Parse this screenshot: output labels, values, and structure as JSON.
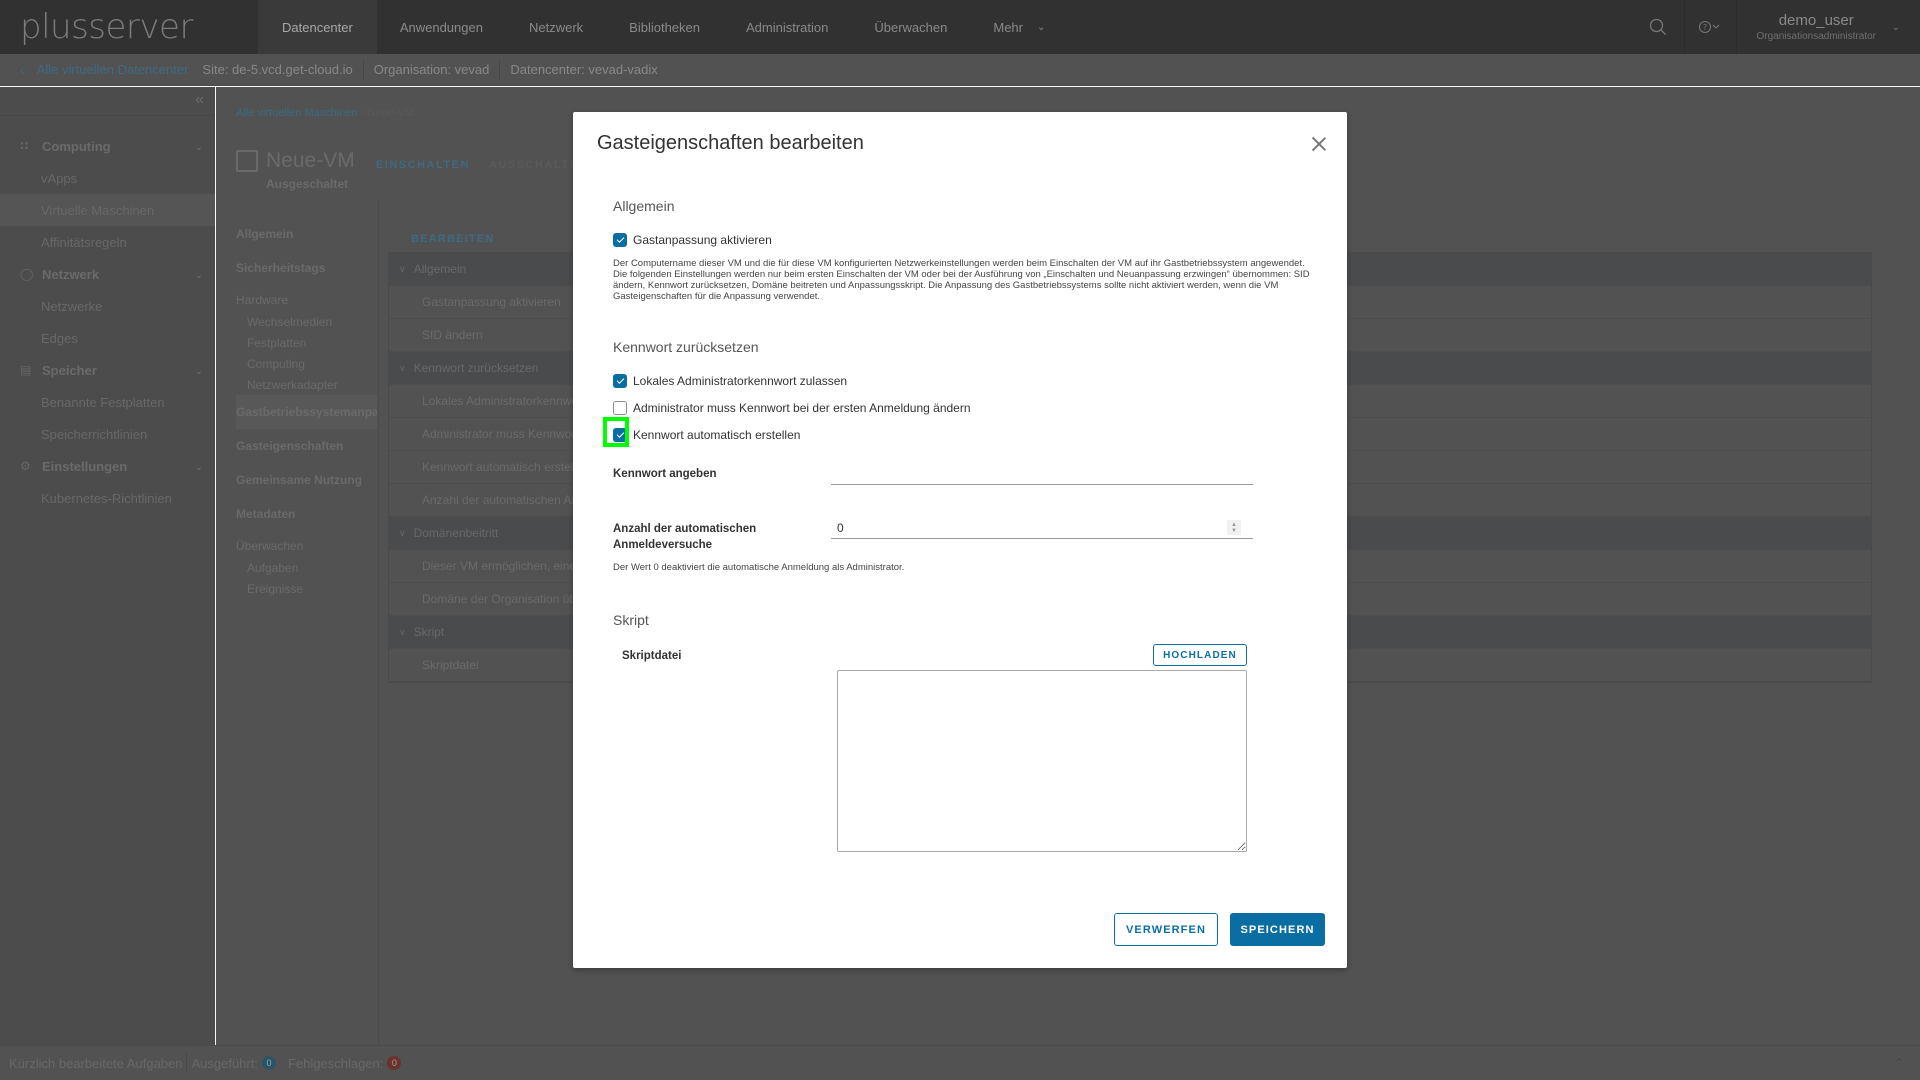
{
  "header": {
    "logo": "plusserver",
    "nav": [
      {
        "label": "Datencenter",
        "active": true
      },
      {
        "label": "Anwendungen"
      },
      {
        "label": "Netzwerk"
      },
      {
        "label": "Bibliotheken"
      },
      {
        "label": "Administration"
      },
      {
        "label": "Überwachen"
      },
      {
        "label": "Mehr"
      }
    ],
    "user_name": "demo_user",
    "user_role": "Organisationsadministrator"
  },
  "subheader": {
    "back_label": "Alle virtuellen Datencenter",
    "site": "Site: de-5.vcd.get-cloud.io",
    "organisation": "Organisation: vevad",
    "datacenter": "Datencenter: vevad-vadix"
  },
  "sidebar": {
    "groups": [
      {
        "label": "Computing",
        "icon": "grid-icon",
        "items": [
          "vApps",
          "Virtuelle Maschinen",
          "Affinitätsregeln"
        ]
      },
      {
        "label": "Netzwerk",
        "icon": "network-icon",
        "items": [
          "Netzwerke",
          "Edges"
        ]
      },
      {
        "label": "Speicher",
        "icon": "storage-icon",
        "items": [
          "Benannte Festplatten",
          "Speicherrichtlinien"
        ]
      },
      {
        "label": "Einstellungen",
        "icon": "gear-icon",
        "items": [
          "Kubernetes-Richtlinien"
        ]
      }
    ],
    "active_item": "Virtuelle Maschinen"
  },
  "main": {
    "breadcrumb_link": "Alle virtuellen Maschinen",
    "breadcrumb_current": "Neue-VM",
    "vm_name": "Neue-VM",
    "vm_status": "Ausgeschaltet",
    "power_on": "EINSCHALTEN",
    "power_off": "AUSSCHALTEN",
    "section_nav": [
      {
        "label": "Allgemein"
      },
      {
        "label": "Sicherheitstags"
      },
      {
        "label": "Hardware",
        "head": true
      },
      {
        "label": "Wechselmedien",
        "sub": true
      },
      {
        "label": "Festplatten",
        "sub": true
      },
      {
        "label": "Computing",
        "sub": true
      },
      {
        "label": "Netzwerkadapter",
        "sub": true
      },
      {
        "label": "Gastbetriebssystemanpassung",
        "active": true
      },
      {
        "label": "Gasteigenschaften"
      },
      {
        "label": "Gemeinsame Nutzung"
      },
      {
        "label": "Metadaten"
      },
      {
        "label": "Überwachen",
        "head": true
      },
      {
        "label": "Aufgaben",
        "sub": true
      },
      {
        "label": "Ereignisse",
        "sub": true
      }
    ],
    "edit_link": "BEARBEITEN",
    "grid": [
      {
        "label": "Allgemein",
        "group": true
      },
      {
        "label": "Gastanpassung aktivieren"
      },
      {
        "label": "SID ändern"
      },
      {
        "label": "Kennwort zurücksetzen",
        "group": true
      },
      {
        "label": "Lokales Administratorkennwort zulassen"
      },
      {
        "label": "Administrator muss Kennwort bei der ersten Anmeldung ändern"
      },
      {
        "label": "Kennwort automatisch erstellen"
      },
      {
        "label": "Anzahl der automatischen Anmeldeversuche"
      },
      {
        "label": "Domänenbeitritt",
        "group": true
      },
      {
        "label": "Dieser VM ermöglichen, einer Domäne beizutreten"
      },
      {
        "label": "Domäne der Organisation übernehmen"
      },
      {
        "label": "Skript",
        "group": true
      },
      {
        "label": "Skriptdatei"
      }
    ]
  },
  "bottombar": {
    "recent_tasks": "Kürzlich bearbeitete Aufgaben",
    "executed_label": "Ausgeführt:",
    "executed_count": "0",
    "failed_label": "Fehlgeschlagen:",
    "failed_count": "0"
  },
  "modal": {
    "title": "Gasteigenschaften bearbeiten",
    "section_general": "Allgemein",
    "enable_customization": {
      "label": "Gastanpassung aktivieren",
      "checked": true
    },
    "general_help": "Der Computername dieser VM und die für diese VM konfigurierten Netzwerkeinstellungen werden beim Einschalten der VM auf ihr Gastbetriebssystem angewendet. Die folgenden Einstellungen werden nur beim ersten Einschalten der VM oder bei der Ausführung von „Einschalten und Neuanpassung erzwingen“ übernommen: SID ändern, Kennwort zurücksetzen, Domäne beitreten und Anpassungsskript. Die Anpassung des Gastbetriebssystems sollte nicht aktiviert werden, wenn die VM Gasteigenschaften für die Anpassung verwendet.",
    "section_password": "Kennwort zurücksetzen",
    "allow_local_admin": {
      "label": "Lokales Administratorkennwort zulassen",
      "checked": true
    },
    "admin_must_change": {
      "label": "Administrator muss Kennwort bei der ersten Anmeldung ändern",
      "checked": false
    },
    "auto_generate": {
      "label": "Kennwort automatisch erstellen",
      "checked": true
    },
    "password_label": "Kennwort angeben",
    "password_value": "",
    "autologon_label": "Anzahl der automatischen Anmeldeversuche",
    "autologon_value": "0",
    "autologon_help": "Der Wert 0 deaktiviert die automatische Anmeldung als Administrator.",
    "section_script": "Skript",
    "script_label": "Skriptdatei",
    "upload_button": "HOCHLADEN",
    "script_value": "",
    "discard_button": "VERWERFEN",
    "save_button": "SPEICHERN"
  },
  "colors": {
    "accent": "#0b6ea3",
    "highlight": "#00ff00",
    "header_bg": "#313131"
  }
}
